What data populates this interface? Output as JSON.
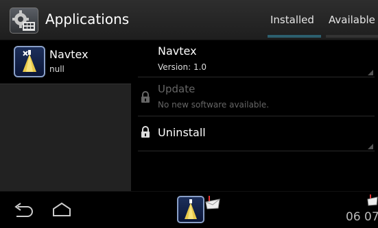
{
  "actionbar": {
    "title": "Applications",
    "tabs": [
      {
        "label": "Installed",
        "selected": true
      },
      {
        "label": "Available",
        "selected": false
      }
    ]
  },
  "list": {
    "items": [
      {
        "title": "Navtex",
        "subtitle": "null"
      }
    ]
  },
  "detail": {
    "name": "Navtex",
    "version": "Version: 1.0",
    "update": {
      "label": "Update",
      "description": "No new software available.",
      "enabled": false
    },
    "uninstall": {
      "label": "Uninstall"
    }
  },
  "statusbar": {
    "time": "06 07"
  },
  "colors": {
    "tab_indicator": "#2c5f6e",
    "disabled_text": "#666666"
  }
}
